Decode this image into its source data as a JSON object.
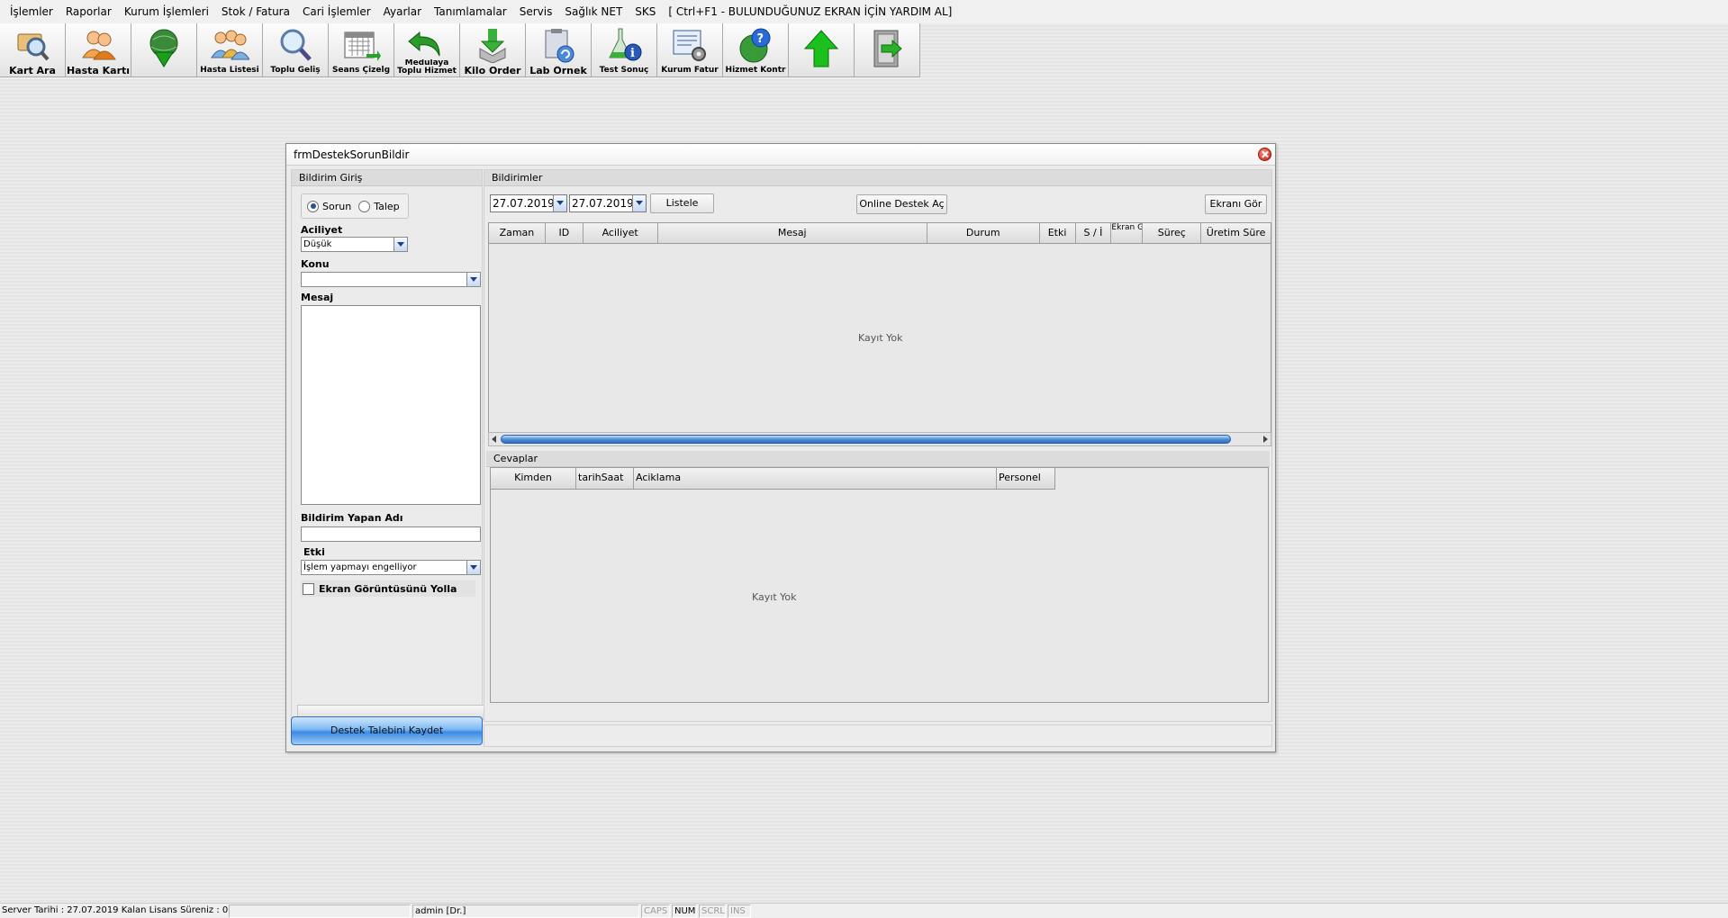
{
  "menu": [
    "İşlemler",
    "Raporlar",
    "Kurum İşlemleri",
    "Stok / Fatura",
    "Cari İşlemler",
    "Ayarlar",
    "Tanımlamalar",
    "Servis",
    "Sağlık NET",
    "SKS",
    "[ Ctrl+F1 - BULUNDUĞUNUZ EKRAN İÇİN YARDIM AL]"
  ],
  "toolbar": [
    {
      "label": "Kart Ara",
      "icon": "magnifier-card-icon"
    },
    {
      "label": "Hasta Kartı",
      "icon": "patients-icon"
    },
    {
      "label": "",
      "icon": "globe-download-icon"
    },
    {
      "label": "Hasta Listesi",
      "icon": "patient-list-icon"
    },
    {
      "label": "Toplu Geliş",
      "icon": "search-icon"
    },
    {
      "label": "Seans Çizelg",
      "icon": "calendar-icon"
    },
    {
      "label": "Medulaya Toplu Hizmet",
      "icon": "undo-arrow-icon"
    },
    {
      "label": "Kilo Order",
      "icon": "download-box-icon"
    },
    {
      "label": "Lab Örnek",
      "icon": "lab-clipboard-icon"
    },
    {
      "label": "Test Sonuç",
      "icon": "flask-info-icon"
    },
    {
      "label": "Kurum Fatur",
      "icon": "invoice-gear-icon"
    },
    {
      "label": "Hizmet Kontr",
      "icon": "help-globe-icon"
    },
    {
      "label": "",
      "icon": "up-arrow-icon"
    },
    {
      "label": "",
      "icon": "exit-door-icon"
    }
  ],
  "dialog": {
    "title": "frmDestekSorunBildir",
    "left": {
      "header": "Bildirim Giriş",
      "radio_sorun": "Sorun",
      "radio_talep": "Talep",
      "aciliyet_label": "Aciliyet",
      "aciliyet_value": "Düşük",
      "konu_label": "Konu",
      "konu_value": "",
      "mesaj_label": "Mesaj",
      "mesaj_value": "",
      "bildirim_yapan_label": "Bildirim Yapan Adı",
      "bildirim_yapan_value": "",
      "etki_label": "Etki",
      "etki_value": "İşlem yapmayı engelliyor",
      "ekran_checkbox_label": "Ekran Görüntüsünü Yolla",
      "save_button": "Destek Talebini Kaydet"
    },
    "right": {
      "header": "Bildirimler",
      "date_from": "27.07.2019",
      "date_to": "27.07.2019",
      "listele_button": "Listele",
      "online_button": "Online Destek Aç",
      "ekrani_gor_button": "Ekranı Gör",
      "columns": [
        "Zaman",
        "ID",
        "Aciliyet",
        "Mesaj",
        "Durum",
        "Etki",
        "S / İ",
        "Ekran Görün",
        "Süreç",
        "Üretim Süre"
      ],
      "empty_text": "Kayıt Yok",
      "cevaplar_header": "Cevaplar",
      "cevaplar_columns": [
        "Kimden",
        "tarihSaat",
        "Aciklama",
        "Personel"
      ],
      "cevaplar_empty_text": "Kayıt Yok"
    }
  },
  "statusbar": {
    "server_info": "Server Tarihi : 27.07.2019  Kalan Lisans Süreniz : 0",
    "user": "admin [Dr.]",
    "caps": "CAPS",
    "num": "NUM",
    "scrl": "SCRL",
    "ins": "INS"
  }
}
